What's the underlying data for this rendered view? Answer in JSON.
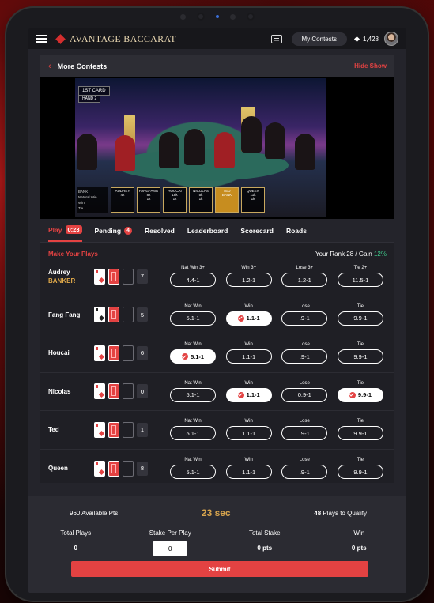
{
  "header": {
    "brand": "AVANTAGE BACCARAT",
    "my_contests_label": "My Contests",
    "points": "1,428"
  },
  "contest_bar": {
    "back_label": "More Contests",
    "hide_show_label": "Hide Show"
  },
  "video": {
    "card_label": "1ST CARD",
    "hand_label": "HAND 2",
    "scoreboard_rows": [
      "BANK",
      "Natural Win",
      "Win",
      "Tie"
    ],
    "scoreboard_players": [
      {
        "name": "AUDREY",
        "v1": "",
        "v2": "4k",
        "v3": ""
      },
      {
        "name": "FANGFANG",
        "v1": "8k",
        "v2": "1k",
        "v3": ""
      },
      {
        "name": "HOUCAI",
        "v1": "18k",
        "v2": "1k",
        "v3": ""
      },
      {
        "name": "NICOLAS",
        "v1": "5k",
        "v2": "1k",
        "v3": ""
      },
      {
        "name": "TED",
        "v1": "BANK",
        "v2": "",
        "v3": ""
      },
      {
        "name": "QUEEN",
        "v1": "11k",
        "v2": "1k",
        "v3": ""
      }
    ]
  },
  "tabs": {
    "play": "Play",
    "play_timer": "0:23",
    "pending": "Pending",
    "pending_count": "4",
    "resolved": "Resolved",
    "leaderboard": "Leaderboard",
    "scorecard": "Scorecard",
    "roads": "Roads"
  },
  "plays": {
    "title": "Make Your Plays",
    "rank_text": "Your Rank 28 / Gain ",
    "gain": "12%",
    "rows": [
      {
        "name": "Audrey",
        "role": "BANKER",
        "score": "7",
        "bets": [
          {
            "label": "Nat Win 3+",
            "odds": "4.4-1",
            "sel": false
          },
          {
            "label": "Win 3+",
            "odds": "1.2-1",
            "sel": false
          },
          {
            "label": "Lose 3+",
            "odds": "1.2-1",
            "sel": false
          },
          {
            "label": "Tie 2+",
            "odds": "11.5-1",
            "sel": false
          }
        ]
      },
      {
        "name": "Fang Fang",
        "role": "",
        "score": "5",
        "bets": [
          {
            "label": "Nat Win",
            "odds": "5.1-1",
            "sel": false
          },
          {
            "label": "Win",
            "odds": "1.1-1",
            "sel": true
          },
          {
            "label": "Lose",
            "odds": ".9-1",
            "sel": false
          },
          {
            "label": "Tie",
            "odds": "9.9-1",
            "sel": false
          }
        ]
      },
      {
        "name": "Houcai",
        "role": "",
        "score": "6",
        "bets": [
          {
            "label": "Nat Win",
            "odds": "5.1-1",
            "sel": true
          },
          {
            "label": "Win",
            "odds": "1.1-1",
            "sel": false
          },
          {
            "label": "Lose",
            "odds": ".9-1",
            "sel": false
          },
          {
            "label": "Tie",
            "odds": "9.9-1",
            "sel": false
          }
        ]
      },
      {
        "name": "Nicolas",
        "role": "",
        "score": "0",
        "bets": [
          {
            "label": "Nat Win",
            "odds": "5.1-1",
            "sel": false
          },
          {
            "label": "Win",
            "odds": "1.1-1",
            "sel": true
          },
          {
            "label": "Lose",
            "odds": "0.9-1",
            "sel": false
          },
          {
            "label": "Tie",
            "odds": "9.9-1",
            "sel": true
          }
        ]
      },
      {
        "name": "Ted",
        "role": "",
        "score": "1",
        "bets": [
          {
            "label": "Nat Win",
            "odds": "5.1-1",
            "sel": false
          },
          {
            "label": "Win",
            "odds": "1.1-1",
            "sel": false
          },
          {
            "label": "Lose",
            "odds": ".9-1",
            "sel": false
          },
          {
            "label": "Tie",
            "odds": "9.9-1",
            "sel": false
          }
        ]
      },
      {
        "name": "Queen",
        "role": "",
        "score": "8",
        "bets": [
          {
            "label": "Nat Win",
            "odds": "5.1-1",
            "sel": false
          },
          {
            "label": "Win",
            "odds": "1.1-1",
            "sel": false
          },
          {
            "label": "Lose",
            "odds": ".9-1",
            "sel": false
          },
          {
            "label": "Tie",
            "odds": "9.9-1",
            "sel": false
          }
        ]
      }
    ]
  },
  "footer": {
    "available": "960 Available Pts",
    "countdown": "23 sec",
    "qualify_count": "48",
    "qualify_text": " Plays to Qualify",
    "total_plays_label": "Total Plays",
    "total_plays": "0",
    "stake_label": "Stake Per Play",
    "stake_value": "0",
    "total_stake_label": "Total Stake",
    "total_stake": "0 pts",
    "win_label": "Win",
    "win": "0 pts",
    "submit_label": "Submit"
  },
  "colors": {
    "accent": "#e34242",
    "gold": "#d7a44d",
    "gain": "#3ecf8e"
  }
}
